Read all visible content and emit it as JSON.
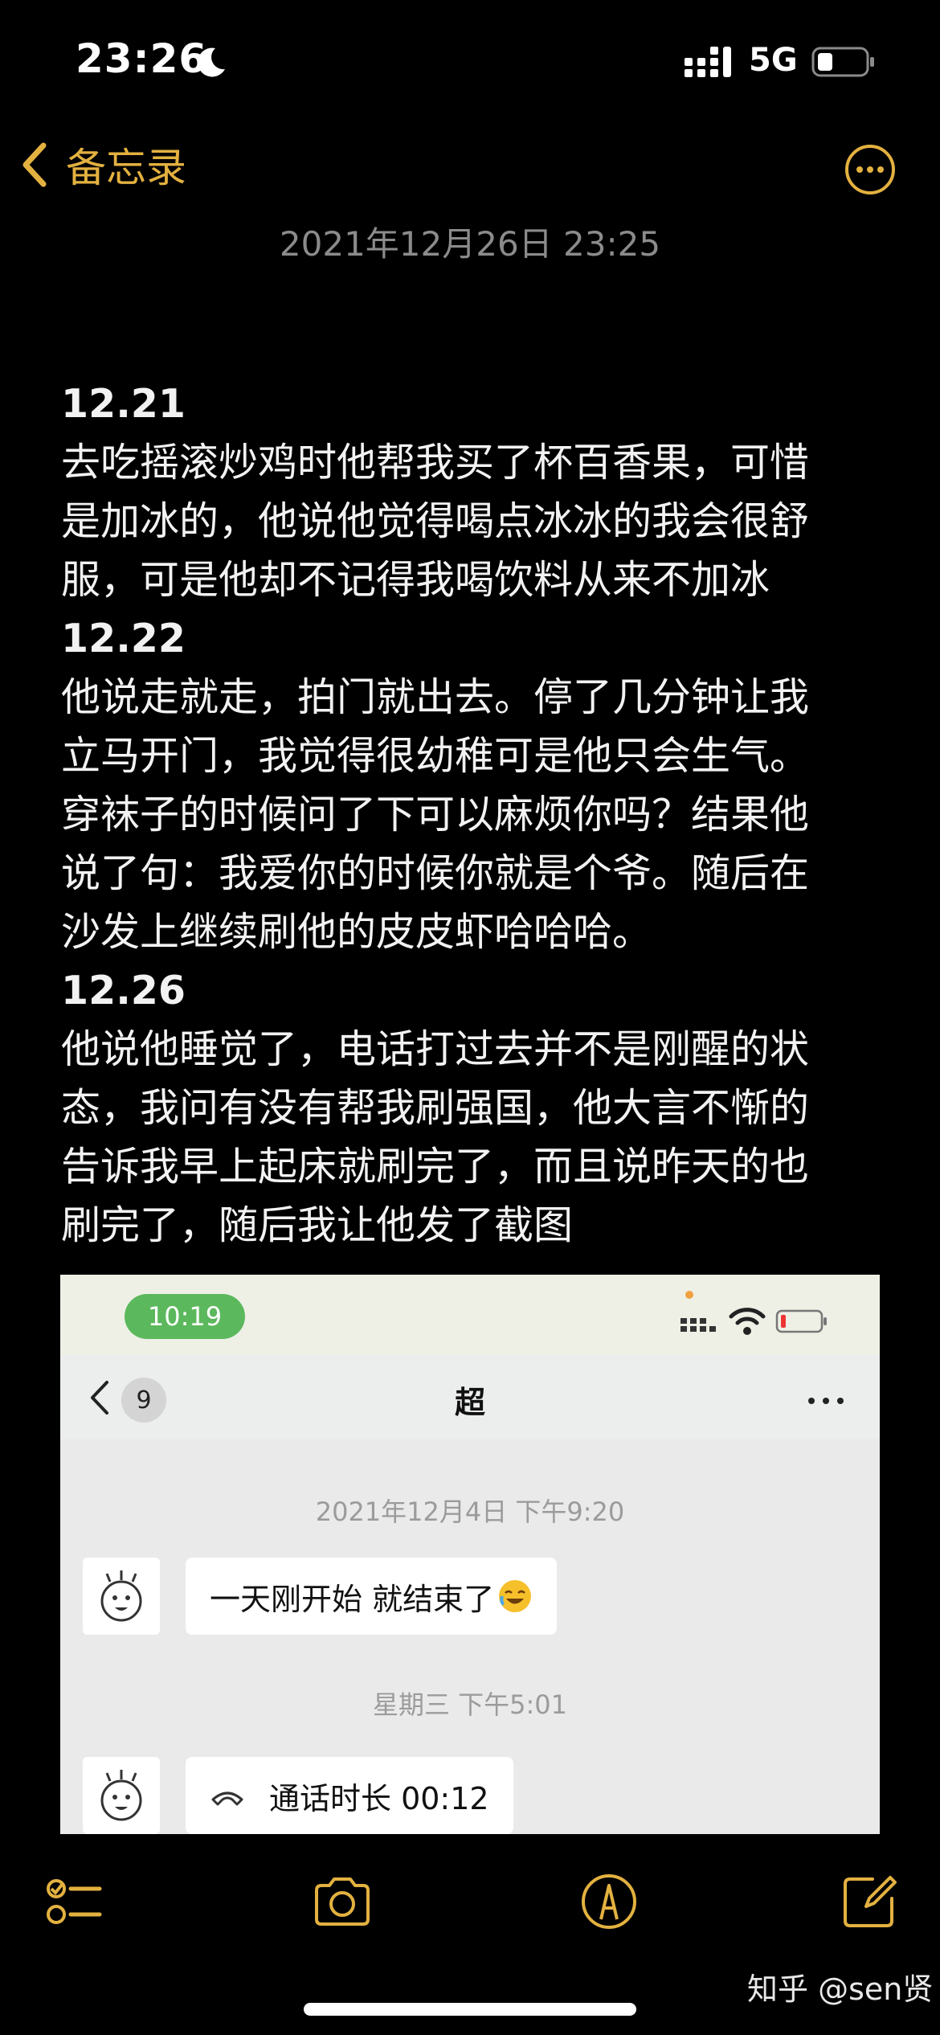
{
  "status_bar": {
    "time": "23:26",
    "network": "5G"
  },
  "nav": {
    "back_label": "备忘录"
  },
  "note": {
    "date": "2021年12月26日 23:25",
    "lines": [
      "12.21",
      "去吃摇滚炒鸡时他帮我买了杯百香果，可惜",
      "是加冰的，他说他觉得喝点冰冰的我会很舒",
      "服，可是他却不记得我喝饮料从来不加冰",
      "12.22",
      "他说走就走，拍门就出去。停了几分钟让我",
      "立马开门，我觉得很幼稚可是他只会生气。",
      "穿袜子的时候问了下可以麻烦你吗？结果他",
      "说了句：我爱你的时候你就是个爷。随后在",
      "沙发上继续刷他的皮皮虾哈哈哈。",
      "12.26",
      "他说他睡觉了，电话打过去并不是刚醒的状",
      "态，我问有没有帮我刷强国，他大言不惭的",
      "告诉我早上起床就刷完了，而且说昨天的也",
      "刷完了，随后我让他发了截图"
    ]
  },
  "embedded_screenshot": {
    "time": "10:19",
    "unread_count": "9",
    "chat_title": "超",
    "timestamp_1": "2021年12月4日 下午9:20",
    "message_1": "一天刚开始 就结束了",
    "timestamp_2": "星期三 下午5:01",
    "call_text": "通话时长 00:12"
  },
  "watermark": "知乎 @sen贤",
  "colors": {
    "accent": "#e3b140",
    "background": "#000000",
    "date_gray": "#8b8b8b"
  }
}
